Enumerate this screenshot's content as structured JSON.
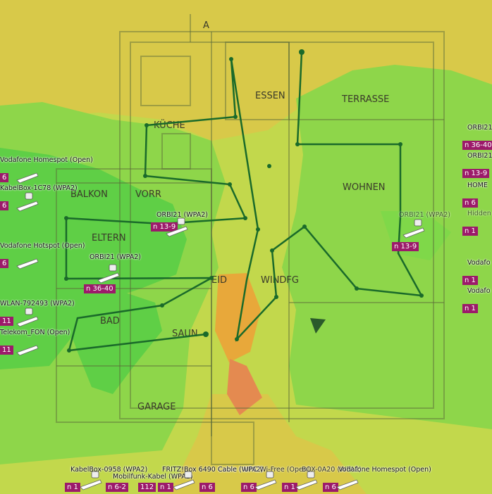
{
  "rooms": {
    "essen": "ESSEN",
    "terrasse": "TERRASSE",
    "kuche": "KÜCHE",
    "balkon": "BALKON",
    "vorr": "VORR",
    "eltern": "ELTERN",
    "wohnen": "WOHNEN",
    "bad": "BAD",
    "windfg": "WINDFG",
    "garage": "GARAGE",
    "saun": "SAUN",
    "north": "A",
    "eid": "EID"
  },
  "colors": {
    "strong": "#5fcf46",
    "medium": "#8ed64a",
    "weak": "#c2d84c",
    "poor": "#d8c949",
    "bad": "#e8a83a",
    "worst": "#e48a50",
    "channel_badge": "#9c1a6a",
    "path": "#1a6a2a"
  },
  "networks": {
    "n01": {
      "name": "Vodafone Homespot (Open)",
      "channel": "6"
    },
    "n02": {
      "name": "KabelBox-1C78 (WPA2)",
      "channel": "6"
    },
    "n03": {
      "name": "Vodafone Hotspot (Open)",
      "channel": "6"
    },
    "n04": {
      "name": "WLAN-792493 (WPA2)",
      "channel": "11"
    },
    "n05": {
      "name": "Telekom_FON (Open)",
      "channel": "11"
    },
    "n06": {
      "name": "ORBI21 (WPA2)",
      "channel": "n 13-9"
    },
    "n07": {
      "name": "ORBI21 (WPA2)",
      "channel": "n 36-40"
    },
    "n08": {
      "name": "ORBI21 (WPA2)",
      "channel": "n 13-9"
    },
    "n09": {
      "name": "ORBI21",
      "channel": "n 36-40"
    },
    "n10": {
      "name": "ORBI21",
      "channel": "n 13-9"
    },
    "n11": {
      "name": "HOME",
      "channel": "n 6"
    },
    "n12": {
      "name": "Hidden",
      "channel": "n 1"
    },
    "n13": {
      "name": "Vodafo",
      "channel": "n 1"
    },
    "n14": {
      "name": "Vodafo",
      "channel": "n 1"
    },
    "n15": {
      "name": "KabelBox-0958 (WPA2)",
      "channel": "n 1"
    },
    "n16": {
      "name": "Mobilfunk-Kabel (WPA2)",
      "channel": "n 6-2"
    },
    "n17": {
      "name": "FRITZ!Box 6490 Cable (WPA2)",
      "channel": "n 1"
    },
    "n18": {
      "name": "112",
      "channel": "112"
    },
    "n19": {
      "name": "Cable (WPA2)",
      "channel": "n 6"
    },
    "n20": {
      "name": "UPC Wi-Free (Open)",
      "channel": "n 6"
    },
    "n21": {
      "name": "BOX-0A20 (WPA2)",
      "channel": "n 1"
    },
    "n22": {
      "name": "Vodafone Homespot (Open)",
      "channel": "n 6"
    }
  }
}
